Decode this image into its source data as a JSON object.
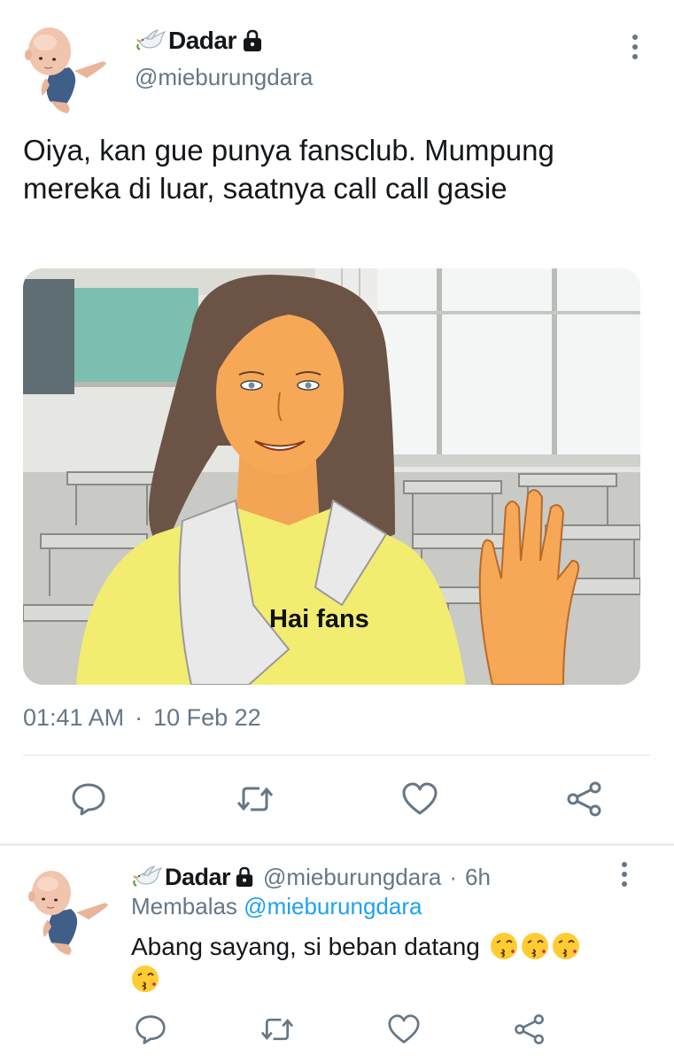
{
  "main_tweet": {
    "author": {
      "display_name": "Dadar",
      "handle": "@mieburungdara",
      "name_prefix_icon": "dove-icon",
      "protected_icon": "lock-icon"
    },
    "text": "Oiya, kan gue punya fansclub. Mumpung mereka di luar, saatnya call call gasie",
    "media": {
      "caption": "Hai fans"
    },
    "time": "01:41 AM",
    "separator": "·",
    "date": "10 Feb 22",
    "actions": [
      "reply-icon",
      "retweet-icon",
      "like-icon",
      "share-icon"
    ]
  },
  "reply": {
    "author": {
      "display_name": "Dadar",
      "handle": "@mieburungdara"
    },
    "separator": "·",
    "time_ago": "6h",
    "replying_prefix": "Membalas",
    "replying_to": "@mieburungdara",
    "text": "Abang sayang, si beban datang",
    "emoji_count": 4,
    "actions": [
      "reply-icon",
      "retweet-icon",
      "like-icon",
      "share-icon"
    ]
  },
  "colors": {
    "text": "#14171a",
    "secondary": "#657786",
    "link": "#1da1f2",
    "divider": "#e1e8ed"
  }
}
